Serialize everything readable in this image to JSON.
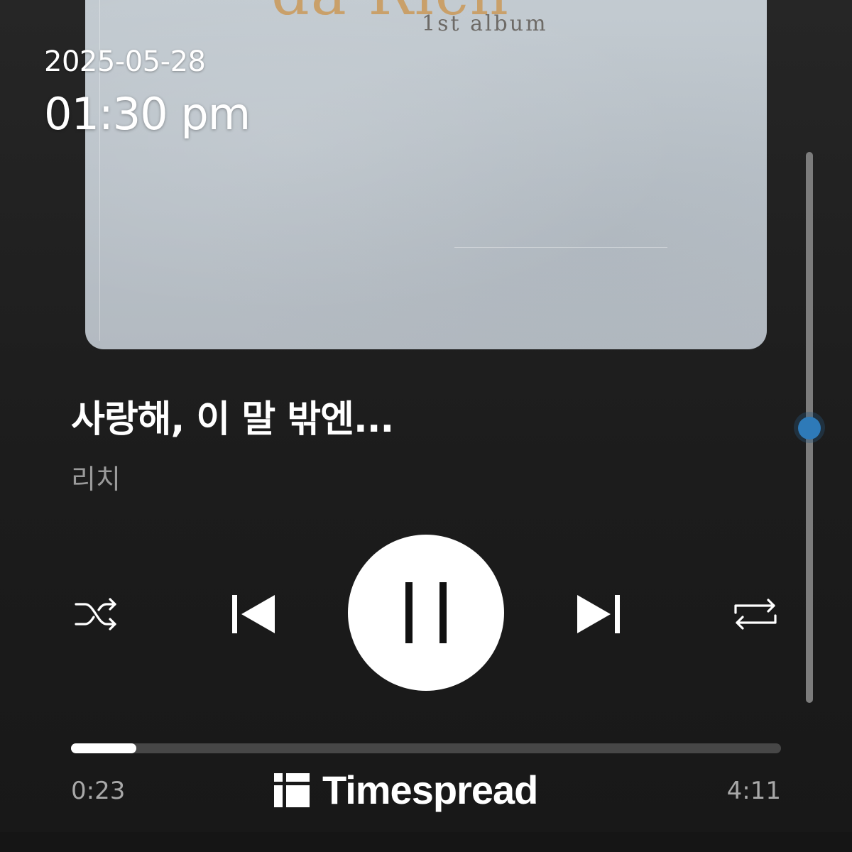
{
  "status": {
    "date": "2025-05-28",
    "time": "01:30 pm"
  },
  "album": {
    "brand_text": "da Rich",
    "subtitle": "1st album",
    "background_color": "#bac2c9"
  },
  "track": {
    "title": "사랑해, 이 말 밖엔...",
    "artist": "리치"
  },
  "controls": {
    "shuffle_icon": "shuffle-icon",
    "previous_icon": "skip-previous-icon",
    "play_pause_icon": "pause-icon",
    "next_icon": "skip-next-icon",
    "repeat_icon": "repeat-icon"
  },
  "progress": {
    "elapsed": "0:23",
    "total": "4:11",
    "fraction": 0.092
  },
  "volume": {
    "level_fraction": 0.5,
    "accent_color": "#2e7ab8"
  },
  "watermark": {
    "text": "Timespread",
    "icon": "timespread-logo-icon"
  }
}
